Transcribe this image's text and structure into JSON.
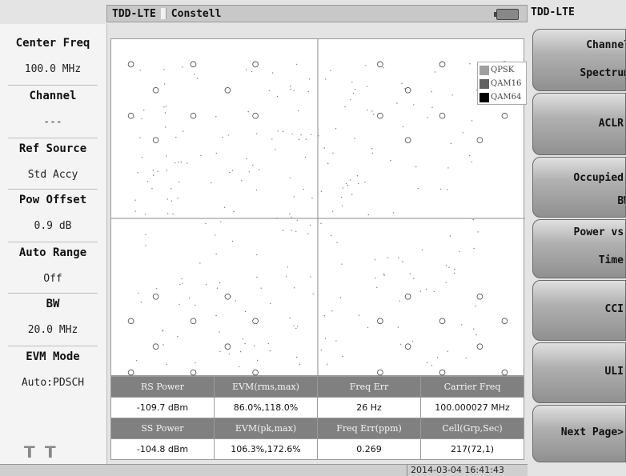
{
  "header": {
    "mode": "TDD-LTE",
    "view": "Constell"
  },
  "parameters": [
    {
      "label": "Center Freq",
      "value": "100.0 MHz"
    },
    {
      "label": "Channel",
      "value": "---"
    },
    {
      "label": "Ref Source",
      "value": "Std Accy"
    },
    {
      "label": "Pow Offset",
      "value": "0.9 dB"
    },
    {
      "label": "Auto Range",
      "value": "Off"
    },
    {
      "label": "BW",
      "value": "20.0 MHz"
    },
    {
      "label": "EVM Mode",
      "value": "Auto:PDSCH"
    }
  ],
  "legend": [
    {
      "name": "QPSK",
      "color": "#a0a0a0"
    },
    {
      "name": "QAM16",
      "color": "#606060"
    },
    {
      "name": "QAM64",
      "color": "#000000"
    }
  ],
  "results": {
    "row1_headers": [
      "RS Power",
      "EVM(rms,max)",
      "Freq Err",
      "Carrier Freq"
    ],
    "row1_values": [
      "-109.7 dBm",
      "86.0%,118.0%",
      "26 Hz",
      "100.000027 MHz"
    ],
    "row2_headers": [
      "SS Power",
      "EVM(pk,max)",
      "Freq Err(ppm)",
      "Cell(Grp,Sec)"
    ],
    "row2_values": [
      "-104.8 dBm",
      "106.3%,172.6%",
      "0.269",
      "217(72,1)"
    ]
  },
  "status": {
    "timestamp": "2014-03-04 16:41:43"
  },
  "softkeys": {
    "title": "TDD-LTE",
    "keys": [
      {
        "line1": "Channel",
        "line2": "Spectrum"
      },
      {
        "line1": "ACLR",
        "line2": ""
      },
      {
        "line1": "Occupied",
        "line2": "BW"
      },
      {
        "line1": "Power vs.",
        "line2": "Time"
      },
      {
        "line1": "CCI",
        "line2": ""
      },
      {
        "line1": "ULI",
        "line2": ""
      },
      {
        "line1": "Next Page>",
        "line2": ""
      }
    ]
  },
  "icons": {
    "antenna_left": "antenna-icon",
    "antenna_right": "antenna-icon",
    "battery": "battery-icon"
  },
  "chart_data": {
    "type": "scatter",
    "title": "",
    "xlabel": "",
    "ylabel": "",
    "xlim": [
      -1,
      1
    ],
    "ylim": [
      -1,
      1
    ],
    "grid": "center-cross",
    "reference_points": {
      "name": "QAM64 ideal",
      "x": [
        -0.926,
        -0.617,
        -0.309,
        0.309,
        0.617,
        0.926,
        -0.926,
        -0.617,
        -0.309,
        0.309,
        0.617,
        0.926,
        -0.926,
        -0.617,
        -0.309,
        0.309,
        0.617,
        0.926,
        -0.926,
        -0.617,
        -0.309,
        0.309,
        0.617,
        0.926
      ],
      "y": [
        0.926,
        0.926,
        0.926,
        0.926,
        0.926,
        0.926,
        0.617,
        0.617,
        0.617,
        0.617,
        0.617,
        0.617,
        -0.617,
        -0.617,
        -0.617,
        -0.617,
        -0.617,
        -0.617,
        -0.926,
        -0.926,
        -0.926,
        -0.926,
        -0.926,
        -0.926
      ]
    }
  }
}
